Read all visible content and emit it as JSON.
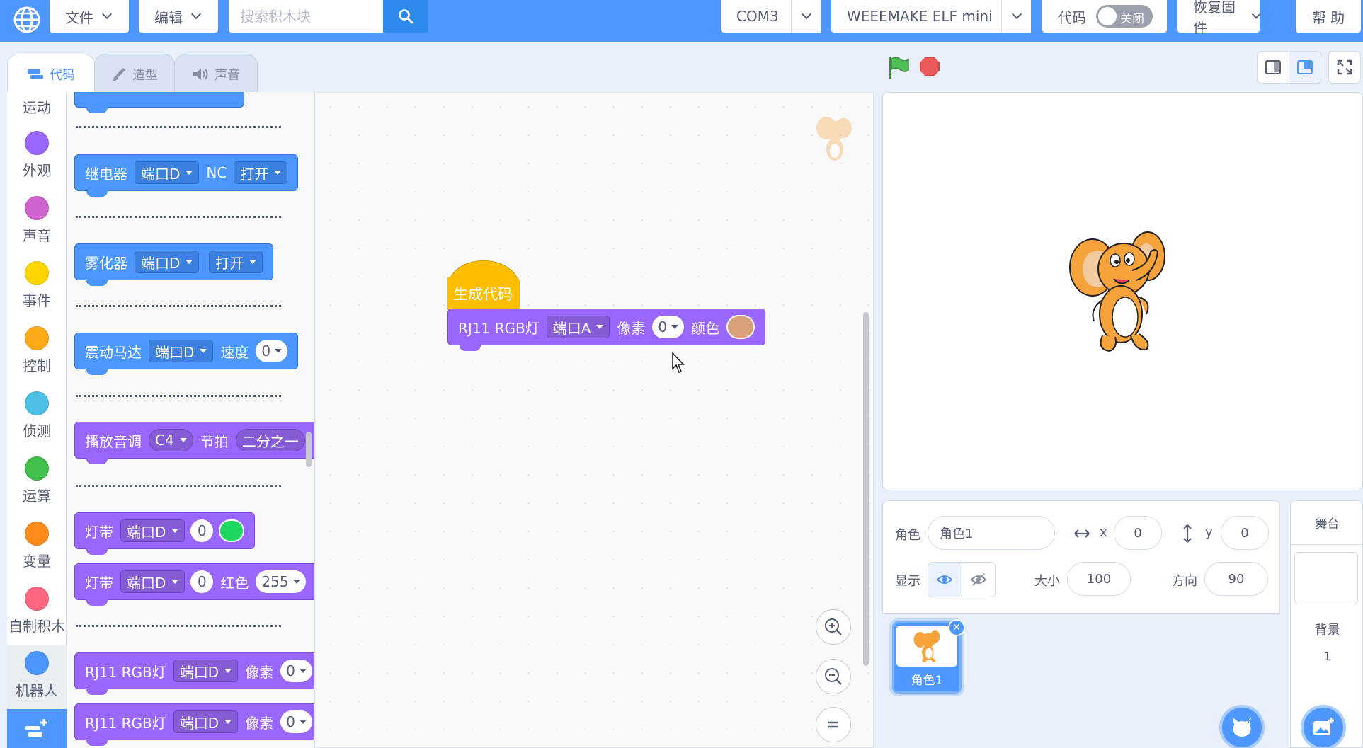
{
  "menubar": {
    "file": "文件",
    "edit": "编辑",
    "search_placeholder": "搜索积木块",
    "port": "COM3",
    "device": "WEEEMAKE ELF mini",
    "code_label": "代码",
    "code_toggle": "关闭",
    "restore_firmware": "恢复固件",
    "help": "帮 助"
  },
  "tabs": [
    "代码",
    "造型",
    "声音"
  ],
  "categories": [
    {
      "label": "运动",
      "color": "#4c97ff"
    },
    {
      "label": "外观",
      "color": "#9966ff"
    },
    {
      "label": "声音",
      "color": "#cf63cf"
    },
    {
      "label": "事件",
      "color": "#ffd500"
    },
    {
      "label": "控制",
      "color": "#ffab19"
    },
    {
      "label": "侦测",
      "color": "#4cbfe6"
    },
    {
      "label": "运算",
      "color": "#40bf4a"
    },
    {
      "label": "变量",
      "color": "#ff8c1a"
    },
    {
      "label": "自制积木",
      "color": "#ff6680"
    },
    {
      "label": "机器人",
      "color": "#4c97ff"
    }
  ],
  "palette": {
    "relay": {
      "name": "继电器",
      "port": "端口D",
      "mode": "NC",
      "state": "打开"
    },
    "atomizer": {
      "name": "雾化器",
      "port": "端口D",
      "state": "打开"
    },
    "vibration": {
      "name": "震动马达",
      "port": "端口D",
      "speed_label": "速度",
      "speed": "0"
    },
    "tone": {
      "name": "播放音调",
      "note": "C4",
      "beat_label": "节拍",
      "beat": "二分之一"
    },
    "strip1": {
      "name": "灯带",
      "port": "端口D",
      "index": "0",
      "color": "#1ed760"
    },
    "strip2": {
      "name": "灯带",
      "port": "端口D",
      "index": "0",
      "channel": "红色",
      "value": "255"
    },
    "rgb1": {
      "name": "RJ11 RGB灯",
      "port": "端口D",
      "pixel_label": "像素",
      "pixel": "0"
    },
    "rgb2": {
      "name": "RJ11 RGB灯",
      "port": "端口D",
      "pixel_label": "像素",
      "pixel": "0"
    }
  },
  "workspace": {
    "hat_label": "生成代码",
    "block": {
      "name": "RJ11 RGB灯",
      "port": "端口A",
      "pixel_label": "像素",
      "pixel": "0",
      "color_label": "颜色",
      "color": "#d9a07c"
    }
  },
  "sprite": {
    "label": "角色",
    "name": "角色1",
    "x_label": "x",
    "x": "0",
    "y_label": "y",
    "y": "0",
    "show_label": "显示",
    "size_label": "大小",
    "size": "100",
    "direction_label": "方向",
    "direction": "90",
    "thumb_name": "角色1"
  },
  "stage_target": {
    "header": "舞台",
    "backdrop_label": "背景",
    "backdrop_count": "1"
  }
}
